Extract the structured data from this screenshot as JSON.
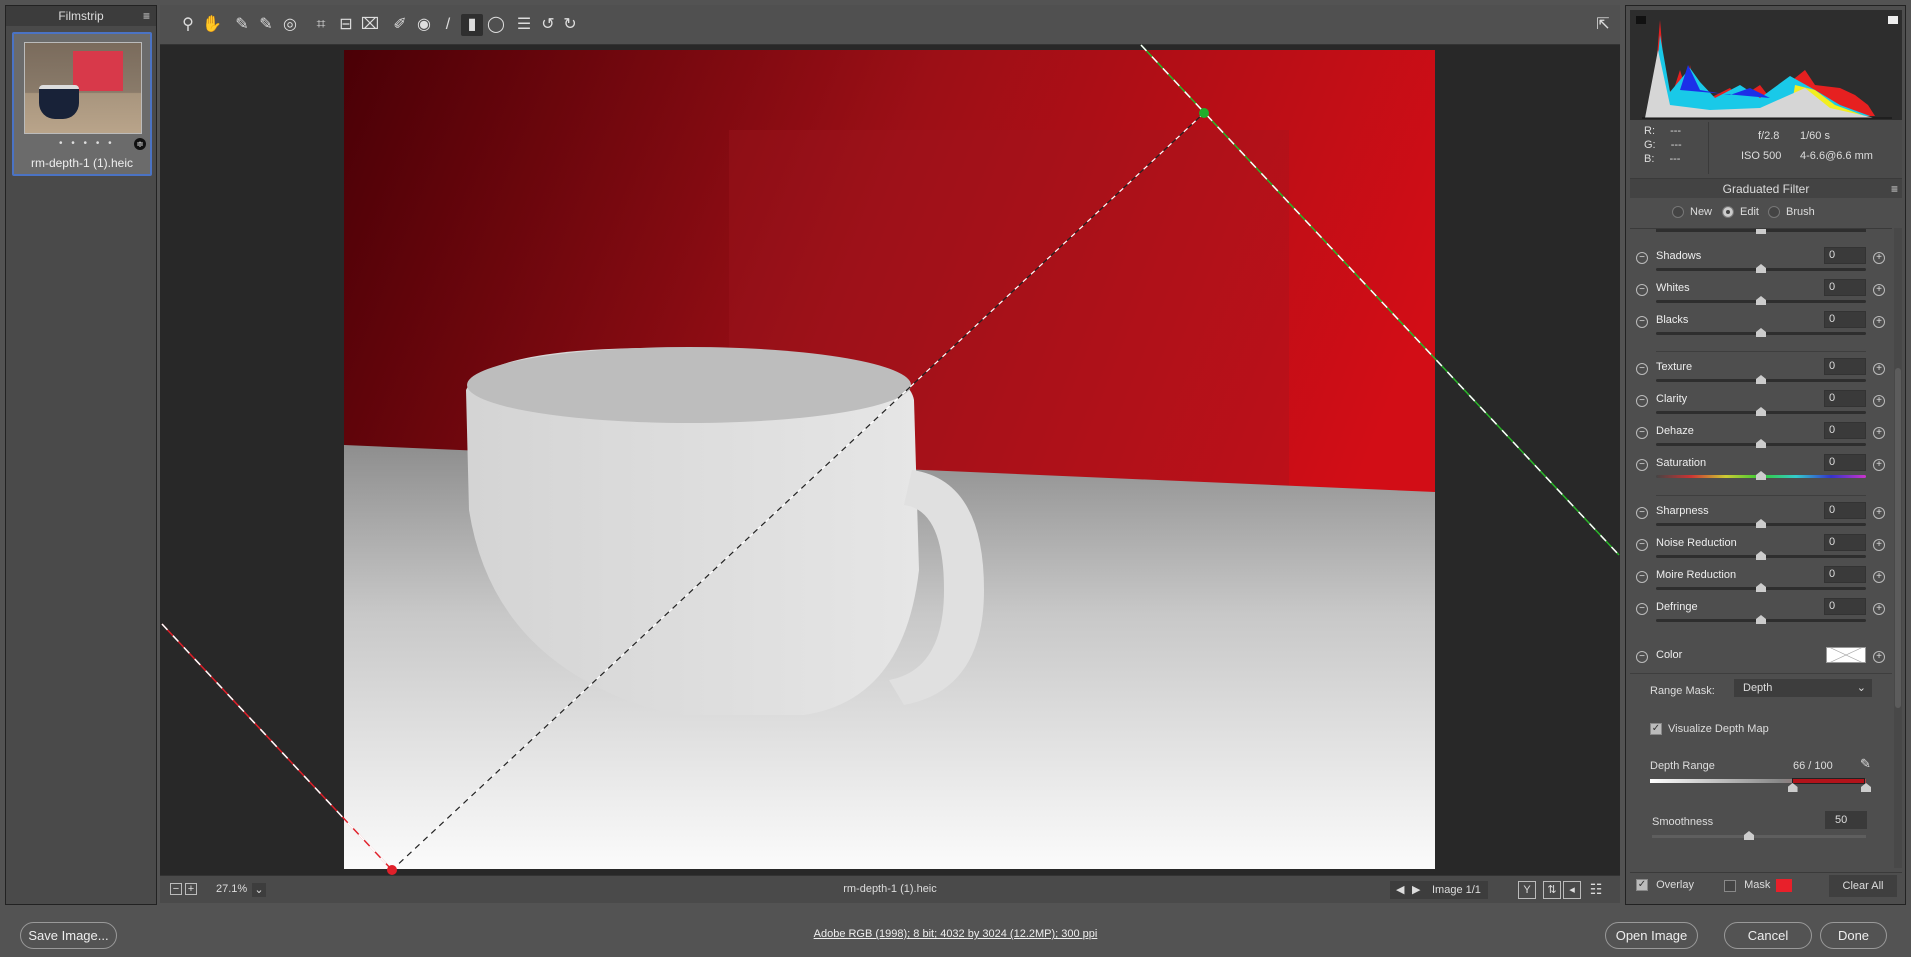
{
  "filmstrip": {
    "title": "Filmstrip",
    "menu_icon": "hamburger-icon",
    "file_name": "rm-depth-1 (1).heic",
    "rating_dots": "• • • • •"
  },
  "toolbar": {
    "tools": [
      {
        "name": "zoom-tool",
        "glyph": "⚲"
      },
      {
        "name": "hand-tool",
        "glyph": "✋"
      },
      {
        "name": "white-balance-tool",
        "glyph": "✎"
      },
      {
        "name": "color-sampler-tool",
        "glyph": "✎"
      },
      {
        "name": "targeted-adjustment-tool",
        "glyph": "◎"
      },
      {
        "name": "crop-tool",
        "glyph": "⌗"
      },
      {
        "name": "straighten-tool",
        "glyph": "⊟"
      },
      {
        "name": "transform-tool",
        "glyph": "⌧"
      },
      {
        "name": "spot-removal-tool",
        "glyph": "✐"
      },
      {
        "name": "red-eye-tool",
        "glyph": "◉"
      },
      {
        "name": "adjustment-brush-tool",
        "glyph": "/"
      },
      {
        "name": "graduated-filter-tool",
        "glyph": "▮",
        "active": true
      },
      {
        "name": "radial-filter-tool",
        "glyph": "◯"
      },
      {
        "name": "preferences-tool",
        "glyph": "☰"
      },
      {
        "name": "rotate-left-tool",
        "glyph": "↺"
      },
      {
        "name": "rotate-right-tool",
        "glyph": "↻"
      }
    ],
    "fullscreen_icon": "fullscreen-toggle-icon"
  },
  "canvas_bar": {
    "zoom": "27.1%",
    "file_name": "rm-depth-1 (1).heic",
    "image_nav": "Image 1/1"
  },
  "histogram": {
    "r": "---",
    "g": "---",
    "b": "---",
    "r_label": "R:",
    "g_label": "G:",
    "b_label": "B:",
    "aperture": "f/2.8",
    "shutter": "1/60 s",
    "iso": "ISO 500",
    "lens": "4-6.6@6.6 mm"
  },
  "panel": {
    "title": "Graduated Filter",
    "modes": [
      {
        "label": "New",
        "selected": false
      },
      {
        "label": "Edit",
        "selected": true
      },
      {
        "label": "Brush",
        "selected": false
      }
    ],
    "sliders": [
      {
        "label": "Shadows",
        "value": "0",
        "group": 1
      },
      {
        "label": "Whites",
        "value": "0",
        "group": 1
      },
      {
        "label": "Blacks",
        "value": "0",
        "group": 1
      },
      {
        "label": "Texture",
        "value": "0",
        "group": 2
      },
      {
        "label": "Clarity",
        "value": "0",
        "group": 2
      },
      {
        "label": "Dehaze",
        "value": "0",
        "group": 2
      },
      {
        "label": "Saturation",
        "value": "0",
        "group": 2
      },
      {
        "label": "Sharpness",
        "value": "0",
        "group": 3
      },
      {
        "label": "Noise Reduction",
        "value": "0",
        "group": 3
      },
      {
        "label": "Moire Reduction",
        "value": "0",
        "group": 3
      },
      {
        "label": "Defringe",
        "value": "0",
        "group": 3
      }
    ],
    "color_label": "Color",
    "range_mask_label": "Range Mask:",
    "range_mask_value": "Depth",
    "visualize_label": "Visualize Depth Map",
    "visualize_checked": true,
    "depth_range_label": "Depth Range",
    "depth_range_value": "66 / 100",
    "depth_range_min": 66,
    "depth_range_max": 100,
    "smoothness_label": "Smoothness",
    "smoothness_value": "50",
    "overlay_label": "Overlay",
    "overlay_checked": true,
    "mask_label": "Mask",
    "mask_checked": false,
    "mask_color": "#e8202a",
    "clear_all": "Clear All"
  },
  "bottom": {
    "save": "Save Image...",
    "color_info": "Adobe RGB (1998); 8 bit; 4032 by 3024 (12.2MP); 300 ppi",
    "open": "Open Image",
    "cancel": "Cancel",
    "done": "Done"
  }
}
